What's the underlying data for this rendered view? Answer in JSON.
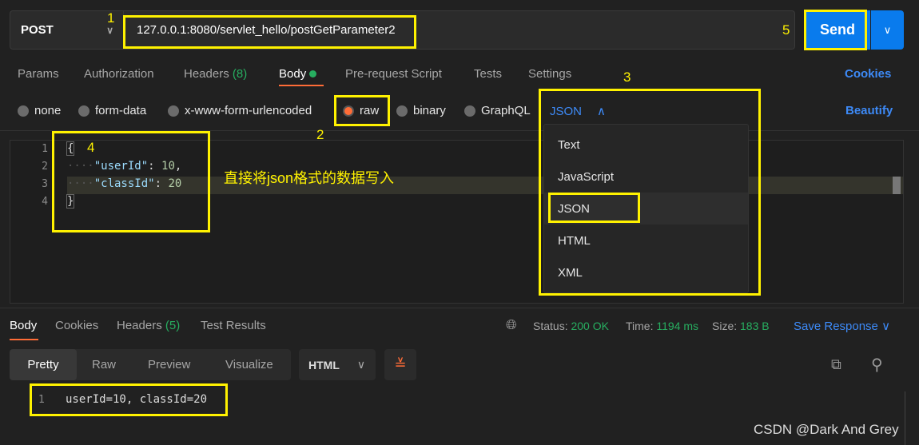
{
  "request": {
    "method": "POST",
    "url": "127.0.0.1:8080/servlet_hello/postGetParameter2",
    "send": "Send"
  },
  "tabs": {
    "params": "Params",
    "authorization": "Authorization",
    "headers": "Headers",
    "headers_count": "(8)",
    "body": "Body",
    "prerequest": "Pre-request Script",
    "tests": "Tests",
    "settings": "Settings",
    "cookies": "Cookies"
  },
  "body_types": {
    "none": "none",
    "form_data": "form-data",
    "urlencoded": "x-www-form-urlencoded",
    "raw": "raw",
    "binary": "binary",
    "graphql": "GraphQL",
    "selected_format": "JSON",
    "beautify": "Beautify"
  },
  "format_menu": [
    "Text",
    "JavaScript",
    "JSON",
    "HTML",
    "XML"
  ],
  "editor": {
    "lines": [
      "1",
      "2",
      "3",
      "4"
    ],
    "open": "{",
    "k1": "\"userId\"",
    "v1": "10",
    "k2": "\"classId\"",
    "v2": "20",
    "close": "}"
  },
  "annotations": {
    "n1": "1",
    "n2": "2",
    "n3": "3",
    "n4": "4",
    "n5": "5",
    "note": "直接将json格式的数据写入"
  },
  "response": {
    "tabs": {
      "body": "Body",
      "cookies": "Cookies",
      "headers": "Headers",
      "headers_count": "(5)",
      "tests": "Test Results"
    },
    "status_label": "Status:",
    "status": "200 OK",
    "time_label": "Time:",
    "time": "1194 ms",
    "size_label": "Size:",
    "size": "183 B",
    "save": "Save Response",
    "views": [
      "Pretty",
      "Raw",
      "Preview",
      "Visualize"
    ],
    "format": "HTML",
    "line": "1",
    "content": "userId=10, classId=20"
  },
  "watermark": "CSDN @Dark And Grey",
  "colors": {
    "accent": "#097bed",
    "active_tab": "#ff6c37",
    "success": "#27ae60",
    "annotation": "#fff200"
  }
}
